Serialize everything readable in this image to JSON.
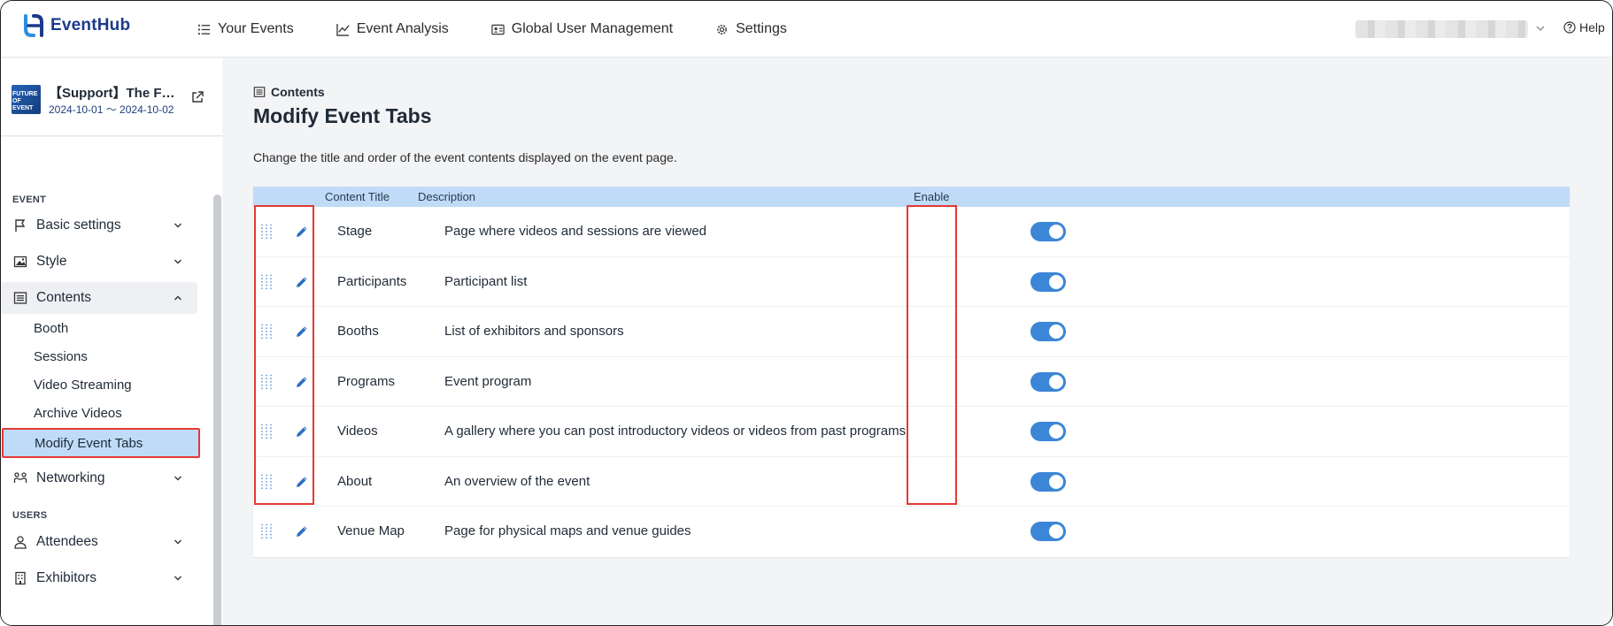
{
  "app": {
    "name": "EventHub",
    "help_label": "Help"
  },
  "nav": [
    {
      "label": "Your Events",
      "icon": "list-icon"
    },
    {
      "label": "Event Analysis",
      "icon": "chart-icon"
    },
    {
      "label": "Global User Management",
      "icon": "id-card-icon"
    },
    {
      "label": "Settings",
      "icon": "gear-icon"
    }
  ],
  "event": {
    "thumb_text": "FUTURE OF EVENT",
    "title": "【Support】The F…",
    "dates": "2024-10-01 〜 2024-10-02"
  },
  "sidebar": {
    "section_event": "EVENT",
    "section_users": "USERS",
    "items": [
      {
        "label": "Basic settings",
        "icon": "flag-icon"
      },
      {
        "label": "Style",
        "icon": "image-icon"
      },
      {
        "label": "Contents",
        "icon": "contents-icon"
      },
      {
        "label": "Networking",
        "icon": "network-icon"
      },
      {
        "label": "Attendees",
        "icon": "user-icon"
      },
      {
        "label": "Exhibitors",
        "icon": "building-icon"
      }
    ],
    "sub_items": [
      {
        "label": "Booth"
      },
      {
        "label": "Sessions"
      },
      {
        "label": "Video Streaming"
      },
      {
        "label": "Archive Videos"
      },
      {
        "label": "Modify Event Tabs"
      }
    ]
  },
  "main": {
    "breadcrumb": "Contents",
    "title": "Modify Event Tabs",
    "description": "Change the title and order of the event contents displayed on the event page.",
    "columns": {
      "title": "Content Title",
      "description": "Description",
      "enable": "Enable"
    },
    "rows": [
      {
        "title": "Stage",
        "description": "Page where videos and sessions are viewed",
        "enabled": true
      },
      {
        "title": "Participants",
        "description": "Participant list",
        "enabled": true
      },
      {
        "title": "Booths",
        "description": "List of exhibitors and sponsors",
        "enabled": true
      },
      {
        "title": "Programs",
        "description": "Event program",
        "enabled": true
      },
      {
        "title": "Videos",
        "description": "A gallery where you can post introductory videos or videos from past programs",
        "enabled": true
      },
      {
        "title": "About",
        "description": "An overview of the event",
        "enabled": true
      },
      {
        "title": "Venue Map",
        "description": "Page for physical maps and venue guides",
        "enabled": true
      }
    ]
  },
  "colors": {
    "brand": "#1a3a8a",
    "accent": "#3b86d6",
    "header_bg": "#bfdbf7",
    "highlight": "#e53935"
  }
}
